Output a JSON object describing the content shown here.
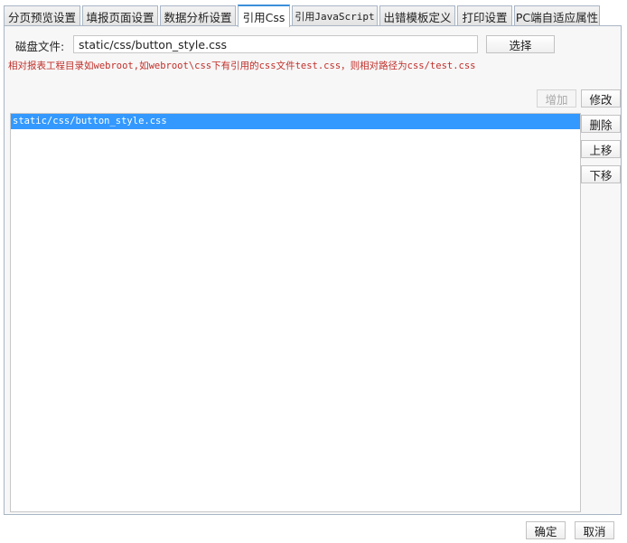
{
  "tabs": [
    {
      "label": "分页预览设置",
      "active": false
    },
    {
      "label": "填报页面设置",
      "active": false
    },
    {
      "label": "数据分析设置",
      "active": false
    },
    {
      "label": "引用Css",
      "active": true
    },
    {
      "label": "引用JavaScript",
      "active": false
    },
    {
      "label": "出错模板定义",
      "active": false
    },
    {
      "label": "打印设置",
      "active": false
    },
    {
      "label": "PC端自适应属性",
      "active": false
    }
  ],
  "disk": {
    "label": "磁盘文件:",
    "value": "static/css/button_style.css",
    "choose_label": "选择"
  },
  "hint_text": "相对报表工程目录如webroot,如webroot\\css下有引用的css文件test.css，则相对路径为css/test.css",
  "side_buttons": {
    "add": "增加",
    "modify": "修改",
    "delete": "删除",
    "up": "上移",
    "down": "下移"
  },
  "css_list": [
    {
      "path": "static/css/button_style.css",
      "selected": true
    }
  ],
  "footer": {
    "ok": "确定",
    "cancel": "取消"
  },
  "colors": {
    "hint": "#c0302b",
    "selection": "#3399ff",
    "active_tab_accent": "#3b8fd9"
  }
}
